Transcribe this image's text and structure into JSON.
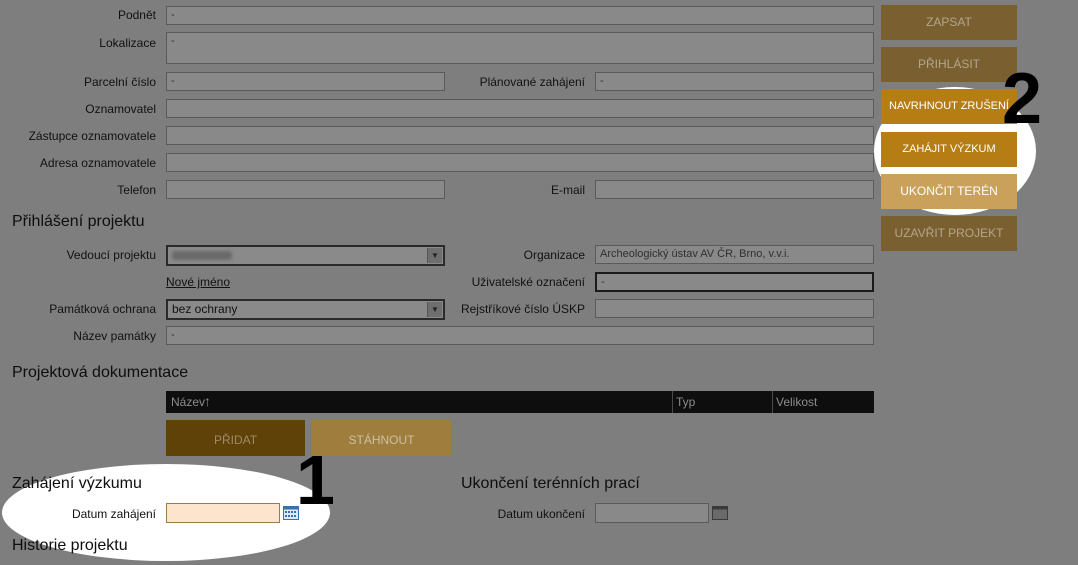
{
  "form": {
    "podnet": {
      "label": "Podnět",
      "value": "-"
    },
    "lokalizace": {
      "label": "Lokalizace",
      "value": "-"
    },
    "parcelni": {
      "label": "Parcelní číslo",
      "value": "-"
    },
    "planovane": {
      "label": "Plánované zahájení",
      "value": "-"
    },
    "oznamovatel": {
      "label": "Oznamovatel",
      "value": ""
    },
    "zastupce": {
      "label": "Zástupce oznamovatele",
      "value": ""
    },
    "adresa": {
      "label": "Adresa oznamovatele",
      "value": ""
    },
    "telefon": {
      "label": "Telefon",
      "value": ""
    },
    "email": {
      "label": "E-mail",
      "value": ""
    }
  },
  "prihlaseni": {
    "title": "Přihlášení projektu",
    "vedouci": {
      "label": "Vedoucí projektu"
    },
    "organizace": {
      "label": "Organizace",
      "value": "Archeologický ústav AV ČR, Brno, v.v.i."
    },
    "nove_jmeno": "Nové jméno",
    "uzivatelske": {
      "label": "Uživatelské označení",
      "value": "-"
    },
    "pamatkova": {
      "label": "Památková ochrana",
      "value": "bez ochrany"
    },
    "rejstrikove": {
      "label": "Rejstříkové číslo ÚSKP",
      "value": ""
    },
    "nazev_pamatky": {
      "label": "Název památky",
      "value": "-"
    }
  },
  "dokumentace": {
    "title": "Projektová dokumentace",
    "columns": [
      "Název",
      "Typ",
      "Velikost"
    ],
    "pridat": "PŘIDAT",
    "stahnout": "STÁHNOUT"
  },
  "zahajeni": {
    "title": "Zahájení výzkumu",
    "label": "Datum zahájení",
    "value": ""
  },
  "ukonceni": {
    "title": "Ukončení terénních prací",
    "label": "Datum ukončení",
    "value": ""
  },
  "historie": {
    "title": "Historie projektu"
  },
  "actions": {
    "zapsat": "ZAPSAT",
    "prihlasit": "PŘIHLÁSIT",
    "navrhnout": "NAVRHNOUT ZRUŠENÍ",
    "zahajit": "ZAHÁJIT VÝZKUM",
    "ukoncit": "UKONČIT TERÉN",
    "uzavrit": "UZAVŘIT PROJEKT"
  },
  "annotations": {
    "one": "1",
    "two": "2"
  },
  "colors": {
    "background": "#7e7e7e",
    "button_brown": "#7a6030",
    "highlight_button": "#b57d14"
  }
}
